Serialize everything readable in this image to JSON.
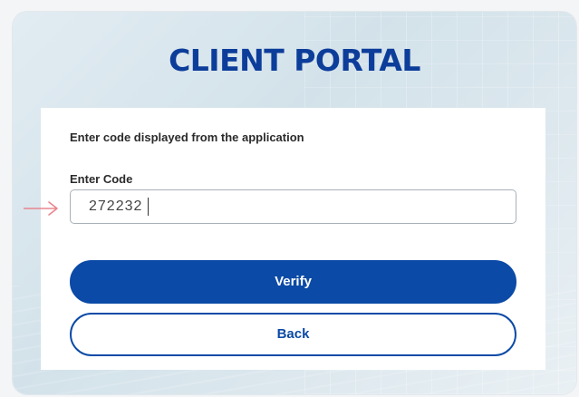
{
  "portal": {
    "title": "CLIENT PORTAL"
  },
  "form": {
    "instruction": "Enter code displayed from the application",
    "code_label": "Enter Code",
    "code_value": "272232"
  },
  "buttons": {
    "verify_label": "Verify",
    "back_label": "Back"
  },
  "annotation": {
    "icon": "arrow-right-icon",
    "color": "#e8868f"
  },
  "colors": {
    "brand": "#0b4aa6",
    "title": "#0c3d9a"
  }
}
